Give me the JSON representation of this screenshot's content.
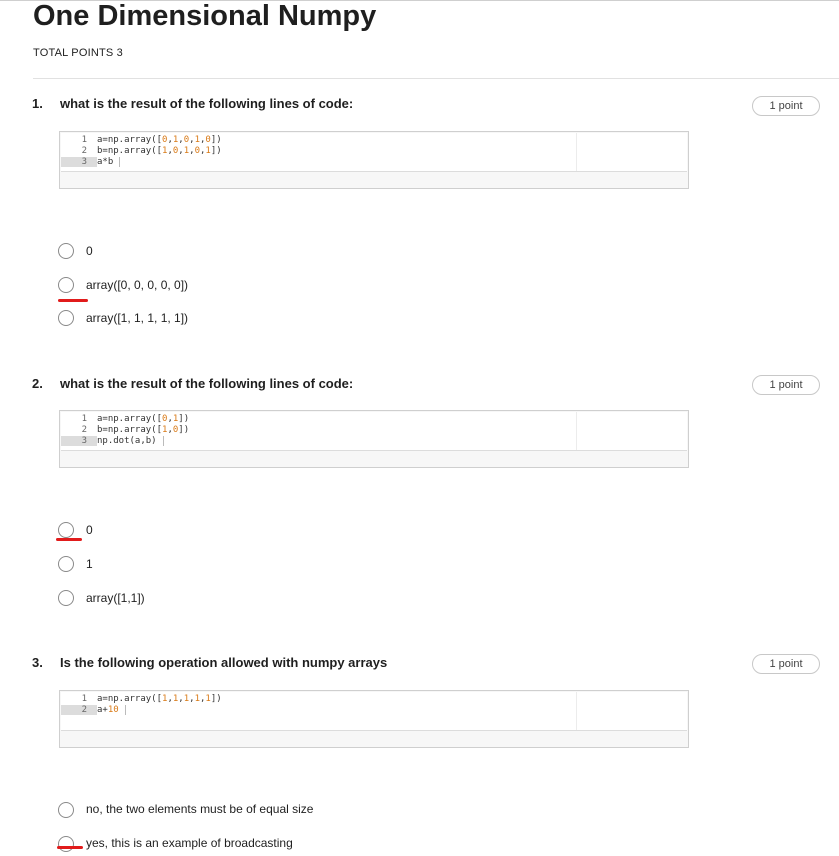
{
  "header": {
    "title": "One Dimensional Numpy",
    "total_points": "TOTAL POINTS 3"
  },
  "questions": [
    {
      "number": "1.",
      "text": "what is the result of the following lines of code:",
      "points": "1 point",
      "code": [
        {
          "ln": "1",
          "parts": [
            "a=np.array([",
            "0",
            ",",
            "1",
            ",",
            "0",
            ",",
            "1",
            ",",
            "0",
            "])"
          ]
        },
        {
          "ln": "2",
          "parts": [
            "b=np.array([",
            "1",
            ",",
            "0",
            ",",
            "1",
            ",",
            "0",
            ",",
            "1",
            "])"
          ]
        },
        {
          "ln": "3",
          "parts": [
            "a*b"
          ]
        }
      ],
      "options": [
        "0",
        "array([0, 0, 0, 0, 0])",
        "array([1, 1, 1, 1, 1])"
      ]
    },
    {
      "number": "2.",
      "text": "what is the result of the following lines of code:",
      "points": "1 point",
      "code": [
        {
          "ln": "1",
          "parts": [
            "a=np.array([",
            "0",
            ",",
            "1",
            "])"
          ]
        },
        {
          "ln": "2",
          "parts": [
            "b=np.array([",
            "1",
            ",",
            "0",
            "])"
          ]
        },
        {
          "ln": "3",
          "parts": [
            "np.dot(a,b)"
          ]
        }
      ],
      "options": [
        "0",
        "1",
        "array([1,1])"
      ]
    },
    {
      "number": "3.",
      "text": "Is the following operation allowed with numpy arrays",
      "points": "1 point",
      "code": [
        {
          "ln": "1",
          "parts": [
            "a=np.array([",
            "1",
            ",",
            "1",
            ",",
            "1",
            ",",
            "1",
            ",",
            "1",
            "])"
          ]
        },
        {
          "ln": "2",
          "parts": [
            "a+",
            "10"
          ]
        }
      ],
      "options": [
        "no, the two elements must be of equal size",
        "yes, this is an example of broadcasting"
      ]
    }
  ]
}
